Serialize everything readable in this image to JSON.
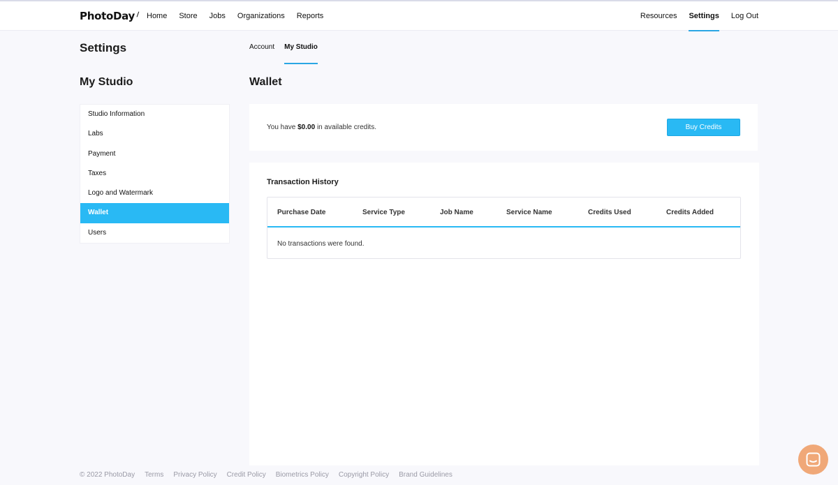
{
  "brand": {
    "logo_text": "PhotoDay"
  },
  "nav": {
    "left": [
      "Home",
      "Store",
      "Jobs",
      "Organizations",
      "Reports"
    ],
    "resources": "Resources",
    "settings": "Settings",
    "logout": "Log Out"
  },
  "page": {
    "title": "Settings"
  },
  "subtabs": {
    "account": "Account",
    "my_studio": "My Studio"
  },
  "sidebar": {
    "title": "My Studio",
    "items": [
      {
        "label": "Studio Information"
      },
      {
        "label": "Labs"
      },
      {
        "label": "Payment"
      },
      {
        "label": "Taxes"
      },
      {
        "label": "Logo and Watermark"
      },
      {
        "label": "Wallet",
        "active": true
      },
      {
        "label": "Users"
      }
    ]
  },
  "wallet": {
    "title": "Wallet",
    "credits_prefix": "You have",
    "credits_amount": "$0.00",
    "credits_suffix": "in available credits.",
    "buy_button": "Buy Credits"
  },
  "history": {
    "title": "Transaction History",
    "columns": [
      "Purchase Date",
      "Service Type",
      "Job Name",
      "Service Name",
      "Credits Used",
      "Credits Added"
    ],
    "empty_message": "No transactions were found."
  },
  "footer": {
    "copyright": "© 2022 PhotoDay",
    "links": [
      "Terms",
      "Privacy Policy",
      "Credit Policy",
      "Biometrics Policy",
      "Copyright Policy",
      "Brand Guidelines"
    ]
  },
  "colors": {
    "accent": "#29b9f4",
    "chat_button": "#f0a878"
  },
  "icons": {
    "chat": "chat-bubble-icon"
  }
}
